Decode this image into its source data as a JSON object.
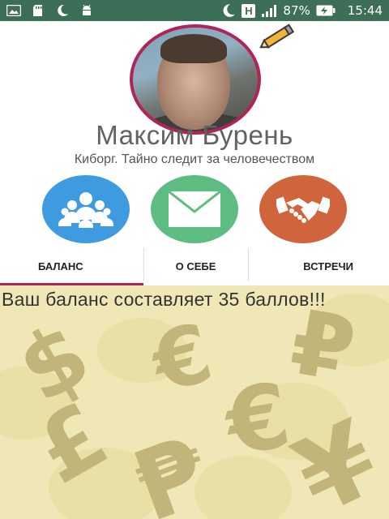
{
  "status_bar": {
    "left_icons": [
      "image-icon",
      "sd-card-icon",
      "moon-icon",
      "android-icon"
    ],
    "right_icons": [
      "moon-icon",
      "hd-icon",
      "signal-icon",
      "battery-charging-icon"
    ],
    "hd_label": "H",
    "battery_percent": "87%",
    "time": "15:44"
  },
  "profile": {
    "name": "Максим Бурень",
    "subtitle": "Киборг. Тайно следит за человечеством",
    "edit_icon": "pencil-icon"
  },
  "actions": [
    {
      "icon": "group-icon",
      "color": "#3f9be0"
    },
    {
      "icon": "mail-icon",
      "color": "#5dbd83"
    },
    {
      "icon": "handshake-icon",
      "color": "#d0643c"
    }
  ],
  "tabs": [
    {
      "label": "БАЛАНС",
      "active": true
    },
    {
      "label": "О СЕБЕ",
      "active": false
    },
    {
      "label": "ВСТРЕЧИ",
      "active": false
    }
  ],
  "content": {
    "balance_text": "Ваш баланс составляет 35 баллов!!!",
    "background_symbols": [
      "$",
      "€",
      "₽",
      "¥",
      "£",
      "₱"
    ]
  },
  "colors": {
    "status_bar": "#3c6e58",
    "accent": "#b1245a",
    "content_bg": "#efe8b6"
  }
}
